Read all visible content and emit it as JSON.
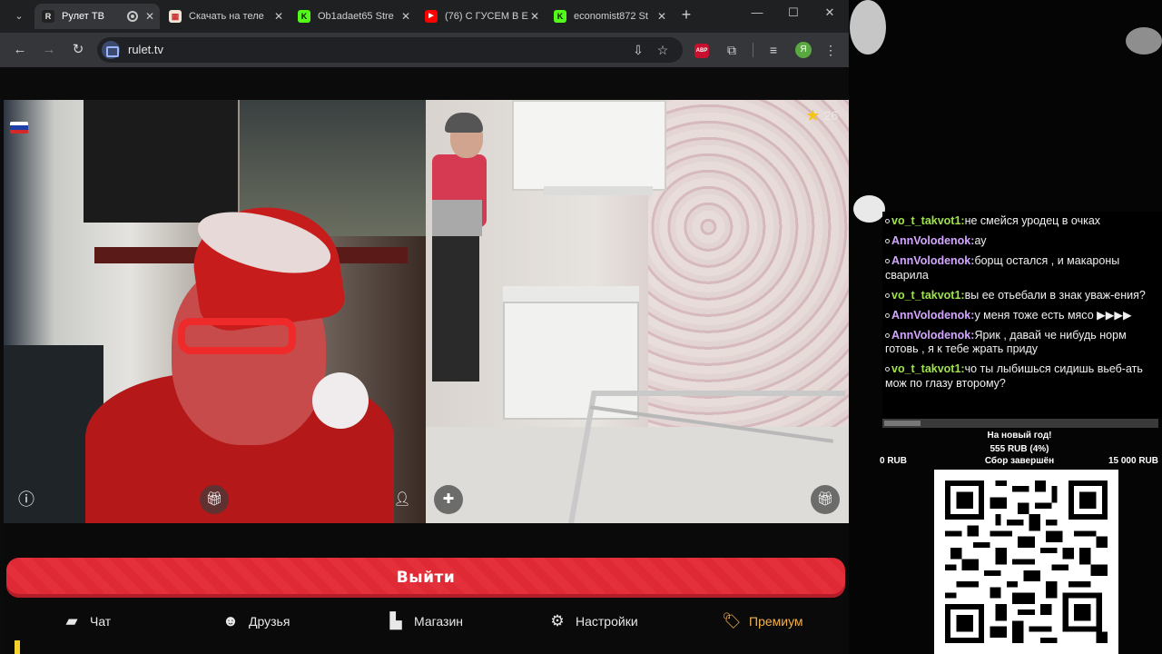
{
  "browser": {
    "tabs": [
      {
        "title": "Рулет ТВ",
        "favicon": "R",
        "favicon_color": "#e8e8e8",
        "favicon_bg": "#222",
        "active": true,
        "recording": true
      },
      {
        "title": "Скачать на теле",
        "favicon": "▦",
        "favicon_color": "#c33",
        "favicon_bg": "#f1e6d8",
        "active": false
      },
      {
        "title": "Ob1adaet65 Stre",
        "favicon": "K",
        "favicon_color": "#111",
        "favicon_bg": "#53fc18",
        "active": false
      },
      {
        "title": "(76) С ГУСЕМ В Е",
        "favicon": "▶",
        "favicon_color": "#fff",
        "favicon_bg": "#ff0000",
        "active": false
      },
      {
        "title": "economist872 St",
        "favicon": "K",
        "favicon_color": "#111",
        "favicon_bg": "#53fc18",
        "active": false
      }
    ],
    "url": "rulet.tv",
    "profile_initial": "Я",
    "extension_abp": "ABP"
  },
  "cams": {
    "left_flag": "russia-flag",
    "rating": "26"
  },
  "exit_label": "Выйти",
  "nav": [
    {
      "label": "Чат",
      "icon": "chat-icon"
    },
    {
      "label": "Друзья",
      "icon": "friends-icon"
    },
    {
      "label": "Магазин",
      "icon": "shop-icon"
    },
    {
      "label": "Настройки",
      "icon": "settings-icon"
    },
    {
      "label": "Премиум",
      "icon": "premium-tag-icon"
    }
  ],
  "chat": [
    {
      "user": "vo_t_takvot1:",
      "color": "green",
      "text": "не смейся уродец в очках"
    },
    {
      "user": "AnnVolodenok:",
      "color": "purple",
      "text": "ау"
    },
    {
      "user": "AnnVolodenok:",
      "color": "purple",
      "text": "борщ остался , и макароны сварила"
    },
    {
      "user": "vo_t_takvot1:",
      "color": "green",
      "text": "вы ее отьебали в знак уваж-ения?"
    },
    {
      "user": "AnnVolodenok:",
      "color": "purple",
      "text": "у меня тоже есть мясо ▶▶▶▶"
    },
    {
      "user": "AnnVolodenok:",
      "color": "purple",
      "text": "Ярик , давай че нибудь норм готовь , я к тебе жрать приду"
    },
    {
      "user": "vo_t_takvot1:",
      "color": "green",
      "text": "чо ты лыбишься сидишь вьеб-ать мож по глазу второму?"
    }
  ],
  "goal": {
    "title": "На новый год!",
    "progress": "555 RUB (4%)",
    "progress_fraction": 0.04,
    "min": "0 RUB",
    "status": "Сбор завершён",
    "max": "15 000 RUB"
  },
  "colors": {
    "exit_red": "#e3303b",
    "premium": "#f4b04a",
    "chat_green": "#9fe34a",
    "chat_purple": "#d3a6ff"
  }
}
